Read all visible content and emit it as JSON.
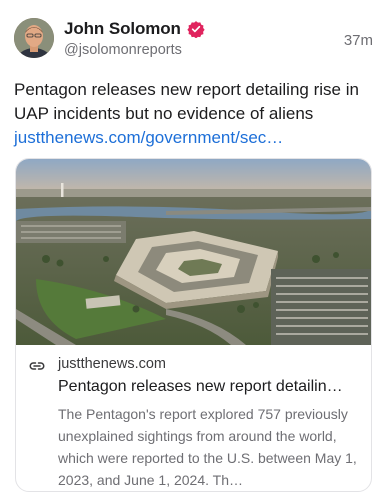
{
  "author": {
    "display_name": "John Solomon",
    "handle": "@jsolomonreports",
    "avatar_icon": "user-avatar",
    "verified_icon": "verified-badge-icon",
    "verified_color": "#e0245e"
  },
  "post": {
    "timestamp": "37m",
    "text": "Pentagon releases new report detailing rise in UAP incidents but no evidence of aliens",
    "link_text": "justthenews.com/government/sec…",
    "link_color": "#1d6fd8"
  },
  "link_card": {
    "image_icon": "pentagon-aerial-photo",
    "link_icon": "link-icon",
    "domain": "justthenews.com",
    "title": "Pentagon releases new report detailin…",
    "description": "The Pentagon's report explored 757 previously unexplained sightings from around the world, which were reported to the U.S. between May 1, 2023, and June 1, 2024. Th…"
  }
}
